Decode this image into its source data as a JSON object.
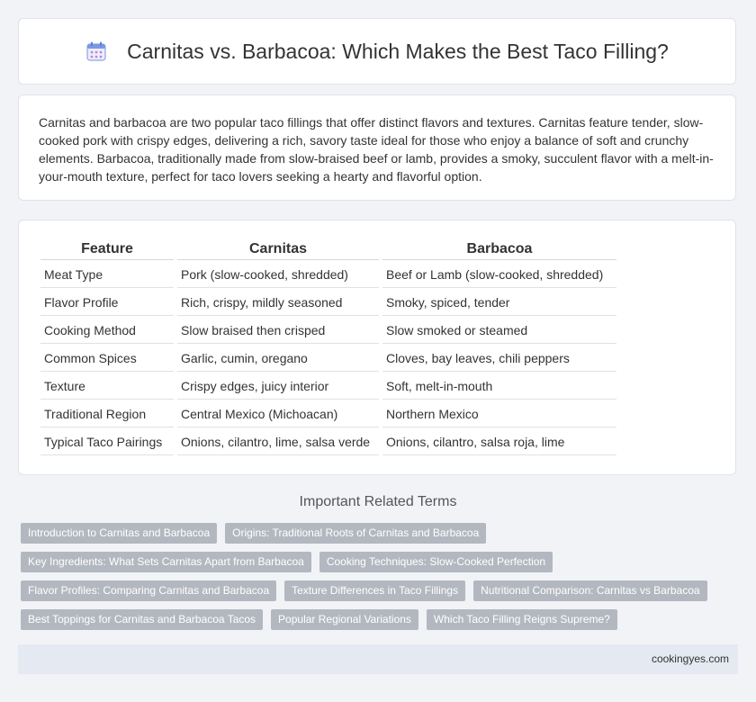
{
  "header": {
    "icon": "calendar-icon",
    "title": "Carnitas vs. Barbacoa: Which Makes the Best Taco Filling?"
  },
  "intro": {
    "text": "Carnitas and barbacoa are two popular taco fillings that offer distinct flavors and textures. Carnitas feature tender, slow-cooked pork with crispy edges, delivering a rich, savory taste ideal for those who enjoy a balance of soft and crunchy elements. Barbacoa, traditionally made from slow-braised beef or lamb, provides a smoky, succulent flavor with a melt-in-your-mouth texture, perfect for taco lovers seeking a hearty and flavorful option."
  },
  "table": {
    "headers": [
      "Feature",
      "Carnitas",
      "Barbacoa"
    ],
    "rows": [
      [
        "Meat Type",
        "Pork (slow-cooked, shredded)",
        "Beef or Lamb (slow-cooked, shredded)"
      ],
      [
        "Flavor Profile",
        "Rich, crispy, mildly seasoned",
        "Smoky, spiced, tender"
      ],
      [
        "Cooking Method",
        "Slow braised then crisped",
        "Slow smoked or steamed"
      ],
      [
        "Common Spices",
        "Garlic, cumin, oregano",
        "Cloves, bay leaves, chili peppers"
      ],
      [
        "Texture",
        "Crispy edges, juicy interior",
        "Soft, melt-in-mouth"
      ],
      [
        "Traditional Region",
        "Central Mexico (Michoacan)",
        "Northern Mexico"
      ],
      [
        "Typical Taco Pairings",
        "Onions, cilantro, lime, salsa verde",
        "Onions, cilantro, salsa roja, lime"
      ]
    ]
  },
  "related": {
    "title": "Important Related Terms",
    "rows": [
      [
        "Introduction to Carnitas and Barbacoa",
        "Origins: Traditional Roots of Carnitas and Barbacoa"
      ],
      [
        "Key Ingredients: What Sets Carnitas Apart from Barbacoa",
        "Cooking Techniques: Slow-Cooked Perfection"
      ],
      [
        "Flavor Profiles: Comparing Carnitas and Barbacoa",
        "Texture Differences in Taco Fillings",
        "Nutritional Comparison: Carnitas vs Barbacoa"
      ],
      [
        "Best Toppings for Carnitas and Barbacoa Tacos",
        "Popular Regional Variations",
        "Which Taco Filling Reigns Supreme?"
      ]
    ]
  },
  "footer": {
    "text": "cookingyes.com"
  },
  "colors": {
    "accent": "#5b7fd6",
    "tag_bg": "#b3b8c0",
    "footer_bg": "#e4e9f2"
  }
}
